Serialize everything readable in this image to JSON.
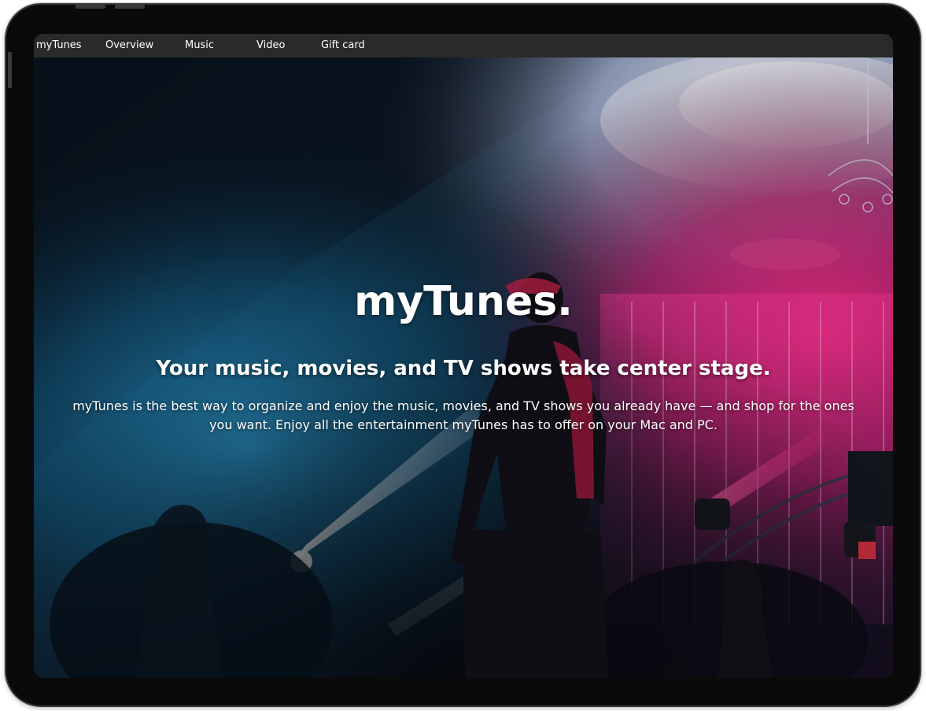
{
  "nav": {
    "brand": "myTunes",
    "items": [
      {
        "label": "Overview"
      },
      {
        "label": "Music"
      },
      {
        "label": "Video"
      },
      {
        "label": "Gift card"
      }
    ]
  },
  "hero": {
    "title": "myTunes.",
    "subtitle": "Your music, movies, and TV shows take center stage.",
    "body": "myTunes is the best way to organize and enjoy the music, movies, and TV shows you already have — and shop for the ones you want. Enjoy all the entertainment myTunes has to offer on your Mac and PC.",
    "background_image": "concert-stage-photo"
  },
  "colors": {
    "navbar": "#2a2a2a",
    "text": "#ffffff",
    "accent_pink": "#e0307a",
    "accent_blue": "#1e6fa0"
  }
}
